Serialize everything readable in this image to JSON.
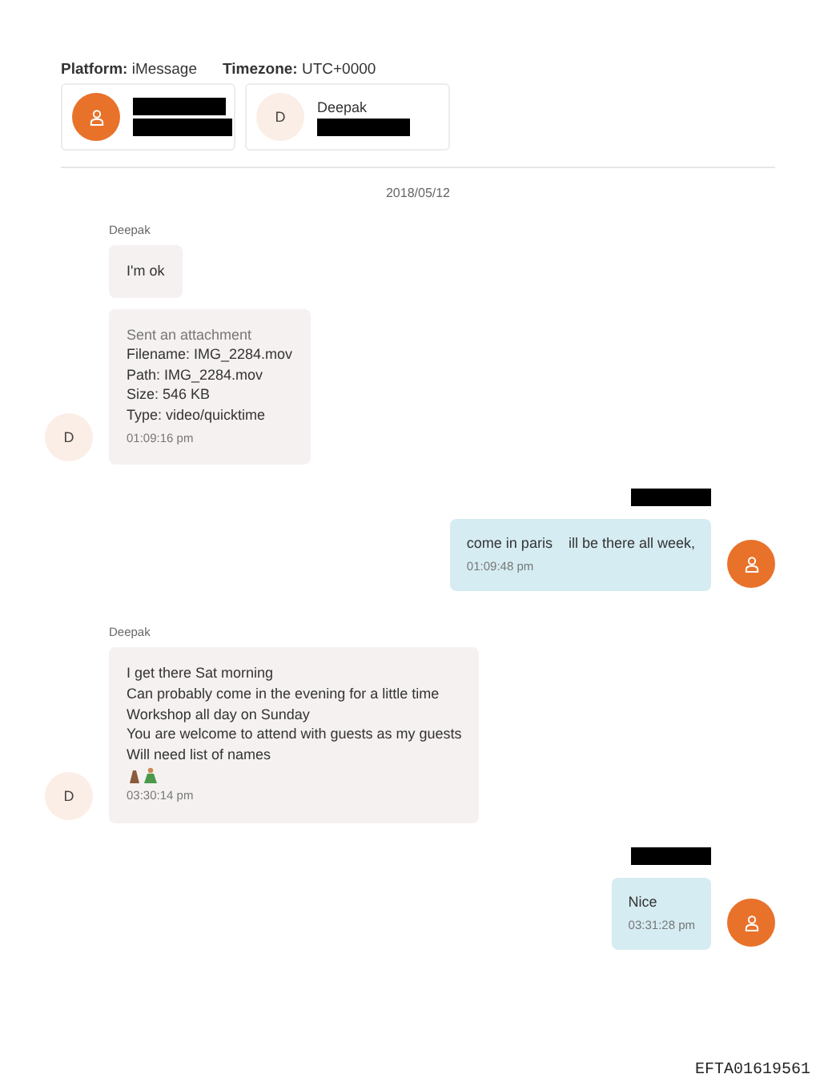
{
  "header": {
    "platform_label": "Platform:",
    "platform": "iMessage",
    "timezone_label": "Timezone:",
    "timezone": "UTC+0000"
  },
  "participants": [
    {
      "kind": "self"
    },
    {
      "kind": "contact",
      "initial": "D",
      "name": "Deepak"
    }
  ],
  "date": "2018/05/12",
  "groups": [
    {
      "kind": "incoming",
      "sender": "Deepak",
      "avatar": "D",
      "messages": [
        {
          "lines": [
            "I'm ok"
          ]
        },
        {
          "header": "Sent an attachment",
          "lines": [
            "Filename: IMG_2284.mov",
            "Path: IMG_2284.mov",
            "Size: 546 KB",
            "Type: video/quicktime"
          ],
          "time": "01:09:16 pm"
        }
      ]
    },
    {
      "kind": "outgoing",
      "sender_redacted": true,
      "messages": [
        {
          "lines": [
            "come in paris    ill be there all week,"
          ],
          "time": "01:09:48 pm"
        }
      ]
    },
    {
      "kind": "incoming",
      "sender": "Deepak",
      "avatar": "D",
      "messages": [
        {
          "lines": [
            "I get there Sat morning",
            "Can probably come in the evening for a little time",
            "Workshop all day on Sunday",
            "You are welcome to attend with guests as my guests",
            "Will need list of names"
          ],
          "emoji": true,
          "time": "03:30:14 pm"
        }
      ]
    },
    {
      "kind": "outgoing",
      "sender_redacted": true,
      "messages": [
        {
          "lines": [
            "Nice"
          ],
          "time": "03:31:28 pm"
        }
      ]
    }
  ],
  "footer": "EFTA01619561"
}
